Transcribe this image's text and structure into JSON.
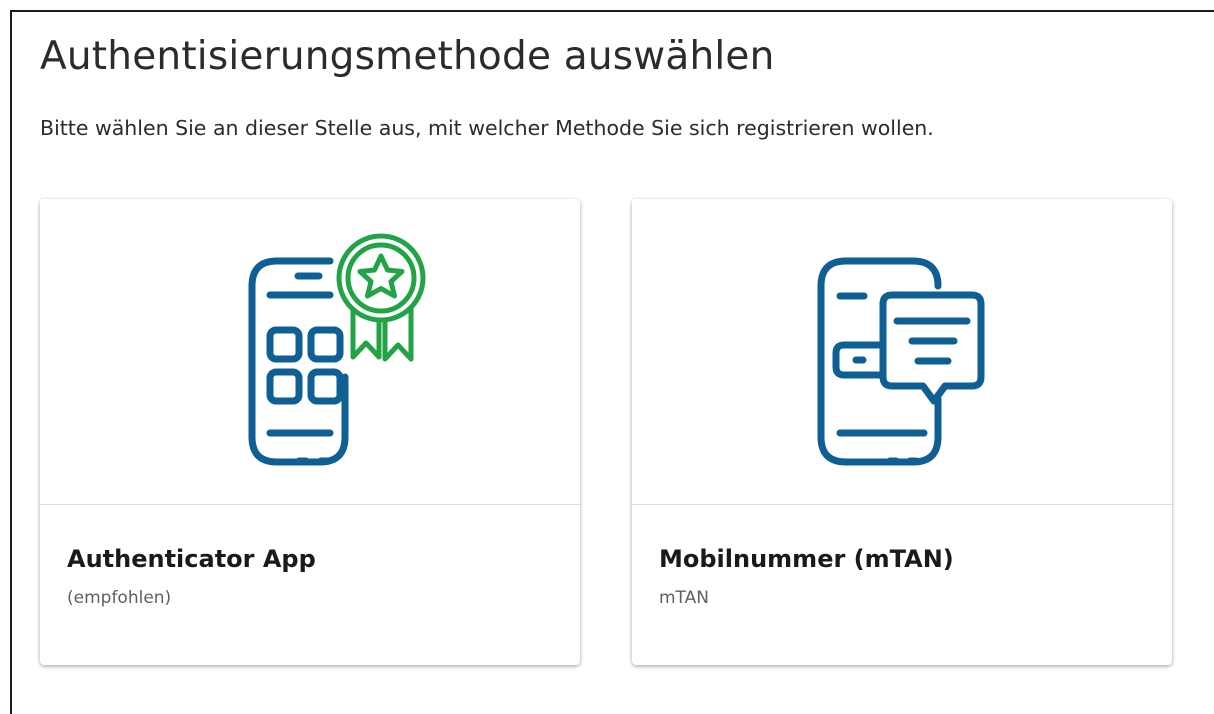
{
  "page": {
    "title": "Authentisierungsmethode auswählen",
    "intro": "Bitte wählen Sie an dieser Stelle aus, mit welcher Methode Sie sich registrieren wollen."
  },
  "colors": {
    "icon_blue": "#0f5e94",
    "badge_green": "#22a346"
  },
  "methods": [
    {
      "title": "Authenticator App",
      "subtitle": "(empfohlen)",
      "icon": "phone-with-award-badge-icon"
    },
    {
      "title": "Mobilnummer (mTAN)",
      "subtitle": "mTAN",
      "icon": "phone-with-message-icon"
    }
  ]
}
